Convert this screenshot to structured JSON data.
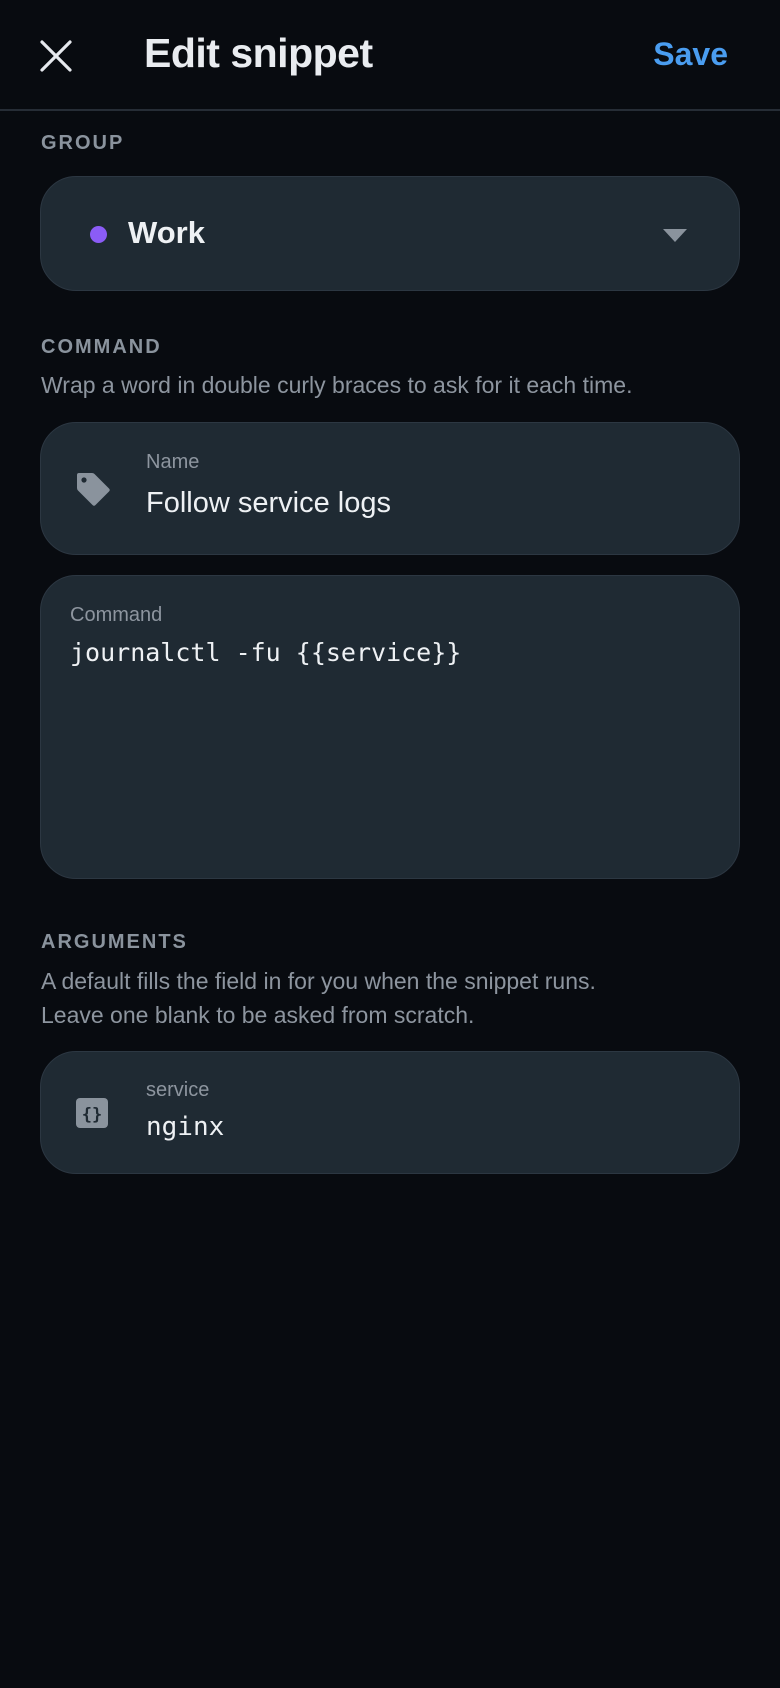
{
  "header": {
    "title": "Edit snippet",
    "save_label": "Save",
    "close_icon": "close-icon"
  },
  "group": {
    "section_label": "GROUP",
    "selected": "Work",
    "dot_color": "#8b5cf6",
    "caret_icon": "chevron-down-icon"
  },
  "command_section": {
    "section_label": "COMMAND",
    "helper": "Wrap a word in double curly braces to ask for it each time.",
    "name_field": {
      "label": "Name",
      "value": "Follow service logs",
      "icon": "tag-icon"
    },
    "command_field": {
      "label": "Command",
      "value": "journalctl -fu {{service}}"
    }
  },
  "arguments_section": {
    "section_label": "ARGUMENTS",
    "helper_line1": "A default fills the field in for you when the snippet runs.",
    "helper_line2": "Leave one blank to be asked from scratch.",
    "args": [
      {
        "label": "service",
        "value": "nginx",
        "icon": "braces-icon"
      }
    ]
  },
  "colors": {
    "background": "#080b10",
    "card": "#1f2a33",
    "accent": "#4a9df0",
    "muted_text": "#8d959f"
  }
}
